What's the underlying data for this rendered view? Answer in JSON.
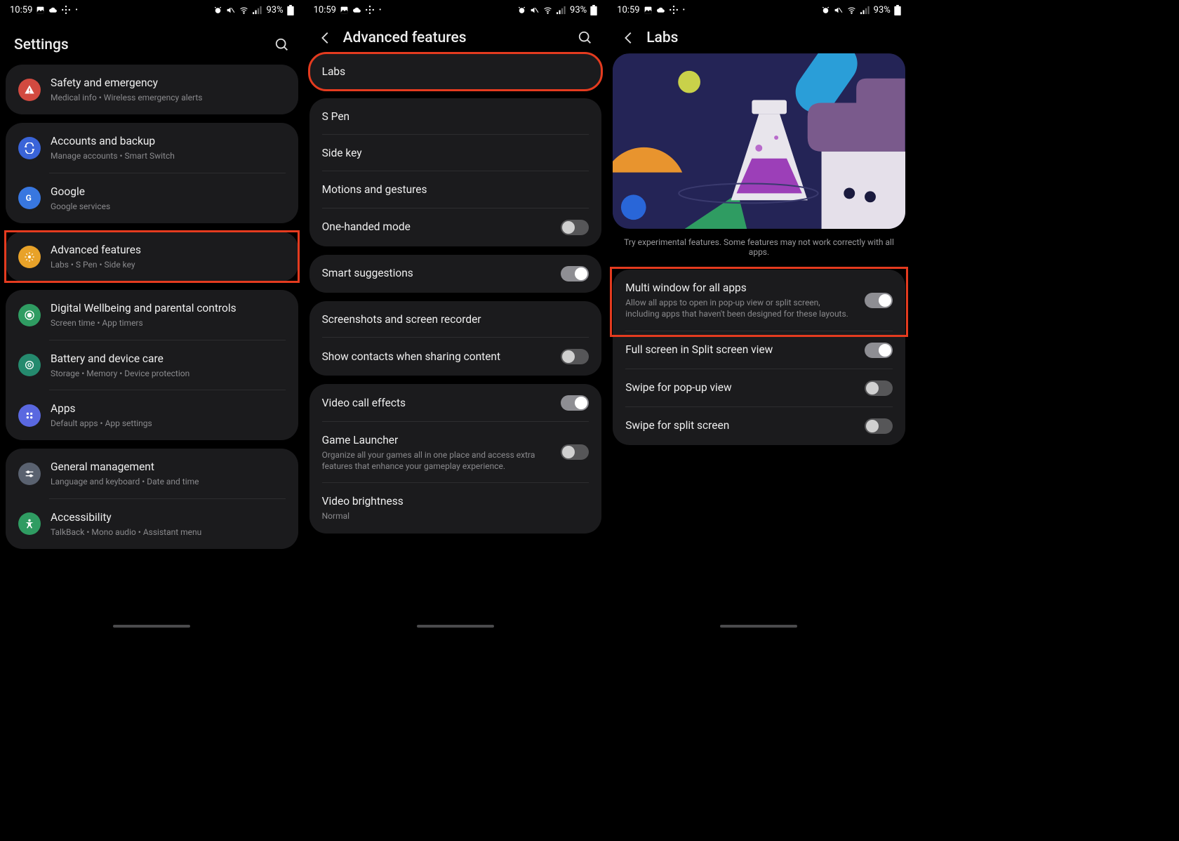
{
  "statusbar": {
    "time": "10:59",
    "battery_pct": "93%"
  },
  "screen1": {
    "title": "Settings",
    "groups": [
      {
        "rows": [
          {
            "icon": "safety",
            "color": "#d24a40",
            "label": "Safety and emergency",
            "sub": "Medical info  •  Wireless emergency alerts"
          }
        ]
      },
      {
        "rows": [
          {
            "icon": "accounts",
            "color": "#3a64d8",
            "label": "Accounts and backup",
            "sub": "Manage accounts  •  Smart Switch"
          },
          {
            "icon": "google",
            "color": "#3877e0",
            "label": "Google",
            "sub": "Google services"
          }
        ]
      },
      {
        "highlight": true,
        "rows": [
          {
            "icon": "advanced",
            "color": "#e8a229",
            "label": "Advanced features",
            "sub": "Labs  •  S Pen  •  Side key"
          }
        ]
      },
      {
        "rows": [
          {
            "icon": "wellbeing",
            "color": "#2f9c62",
            "label": "Digital Wellbeing and parental controls",
            "sub": "Screen time  •  App timers"
          },
          {
            "icon": "battery",
            "color": "#258a6e",
            "label": "Battery and device care",
            "sub": "Storage  •  Memory  •  Device protection"
          },
          {
            "icon": "apps",
            "color": "#5a68e0",
            "label": "Apps",
            "sub": "Default apps  •  App settings"
          }
        ]
      },
      {
        "rows": [
          {
            "icon": "general",
            "color": "#5a6270",
            "label": "General management",
            "sub": "Language and keyboard  •  Date and time"
          },
          {
            "icon": "accessibility",
            "color": "#2f9c62",
            "label": "Accessibility",
            "sub": "TalkBack  •  Mono audio  •  Assistant menu"
          }
        ]
      }
    ]
  },
  "screen2": {
    "title": "Advanced features",
    "groups": [
      {
        "highlight": true,
        "rows": [
          {
            "label": "Labs"
          }
        ]
      },
      {
        "rows": [
          {
            "label": "S Pen"
          },
          {
            "label": "Side key"
          },
          {
            "label": "Motions and gestures"
          },
          {
            "label": "One-handed mode",
            "toggle": false
          }
        ]
      },
      {
        "rows": [
          {
            "label": "Smart suggestions",
            "toggle": true
          }
        ]
      },
      {
        "rows": [
          {
            "label": "Screenshots and screen recorder"
          },
          {
            "label": "Show contacts when sharing content",
            "toggle": false
          }
        ]
      },
      {
        "rows": [
          {
            "label": "Video call effects",
            "toggle": true
          },
          {
            "label": "Game Launcher",
            "sub": "Organize all your games all in one place and access extra features that enhance your gameplay experience.",
            "toggle": false
          },
          {
            "label": "Video brightness",
            "sub": "Normal"
          }
        ]
      }
    ]
  },
  "screen3": {
    "title": "Labs",
    "help": "Try experimental features. Some features may not work correctly with all apps.",
    "rows": [
      {
        "label": "Multi window for all apps",
        "sub": "Allow all apps to open in pop-up view or split screen, including apps that haven't been designed for these layouts.",
        "toggle": true,
        "highlight": true
      },
      {
        "label": "Full screen in Split screen view",
        "toggle": true
      },
      {
        "label": "Swipe for pop-up view",
        "toggle": false
      },
      {
        "label": "Swipe for split screen",
        "toggle": false
      }
    ]
  }
}
